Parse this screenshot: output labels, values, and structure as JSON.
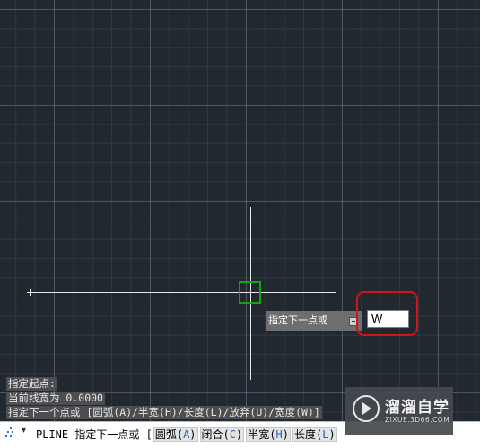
{
  "history": {
    "line1": "指定起点:",
    "line2": "当前线宽为 0.0000",
    "line3": "指定下一个点或 [圆弧(A)/半宽(H)/长度(L)/放弃(U)/宽度(W)]"
  },
  "tooltip": {
    "prompt": "指定下一点或",
    "input_value": "W"
  },
  "command_line": {
    "command": "PLINE",
    "prompt": "指定下一点或 [",
    "options": [
      {
        "label": "圆弧",
        "key": "A"
      },
      {
        "label": "闭合",
        "key": "C"
      },
      {
        "label": "半宽",
        "key": "H"
      },
      {
        "label": "长度",
        "key": "L"
      }
    ]
  },
  "watermark": {
    "name": "溜溜自学",
    "url": "ZIXUE.3D66.COM"
  },
  "colors": {
    "canvas_bg": "#212830",
    "pickbox": "#17a117",
    "highlight_ring": "#d0161b"
  },
  "icons": [
    "command-grip-icon",
    "dropdown-arrow-icon",
    "option-list-icon",
    "play-logo-icon"
  ]
}
